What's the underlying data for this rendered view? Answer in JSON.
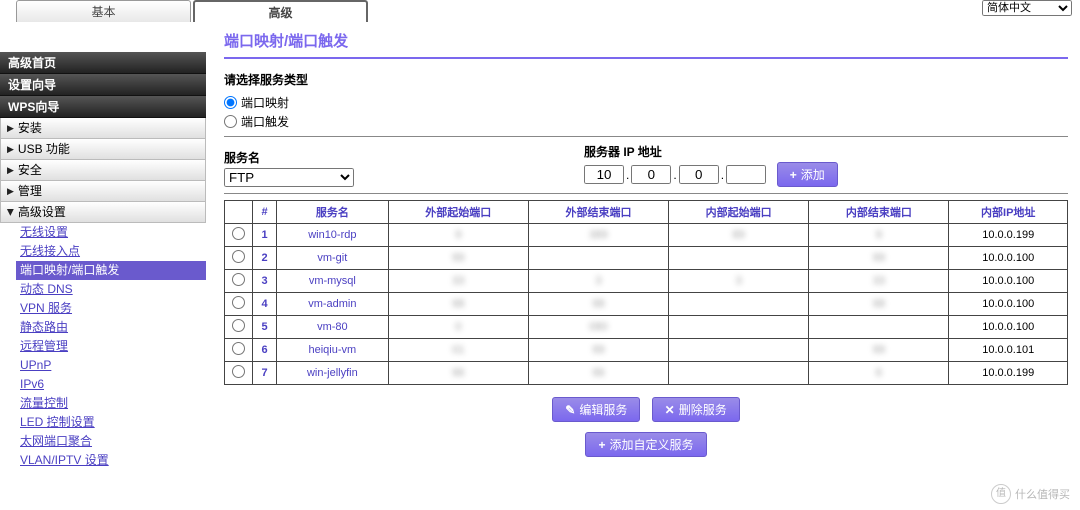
{
  "lang_selected": "简体中文",
  "tabs": {
    "basic": "基本",
    "advanced": "高级"
  },
  "sidebar": {
    "heads": [
      "高级首页",
      "设置向导",
      "WPS向导"
    ],
    "items": [
      "安装",
      "USB 功能",
      "安全",
      "管理",
      "高级设置"
    ],
    "subs": [
      "无线设置",
      "无线接入点",
      "端口映射/端口触发",
      "动态 DNS",
      "VPN 服务",
      "静态路由",
      "远程管理",
      "UPnP",
      "IPv6",
      "流量控制",
      "LED 控制设置",
      "太网端口聚合",
      "VLAN/IPTV 设置"
    ]
  },
  "page": {
    "title": "端口映射/端口触发",
    "select_type": "请选择服务类型",
    "radio1": "端口映射",
    "radio2": "端口触发",
    "service_name": "服务名",
    "service_selected": "FTP",
    "server_ip": "服务器 IP 地址",
    "ip": [
      "10",
      "0",
      "0",
      ""
    ],
    "add_btn": "添加",
    "edit_btn": "编辑服务",
    "del_btn": "删除服务",
    "custom_btn": "添加自定义服务"
  },
  "table": {
    "headers": [
      "",
      "#",
      "服务名",
      "外部起始端口",
      "外部结束端口",
      "内部起始端口",
      "内部结束端口",
      "内部IP地址"
    ],
    "rows": [
      {
        "n": "1",
        "name": "win10-rdp",
        "c1": "9",
        "c2": "389",
        "c3": "89",
        "c4": "9",
        "ip": "10.0.0.199"
      },
      {
        "n": "2",
        "name": "vm-git",
        "c1": "99",
        "c2": "",
        "c3": "",
        "c4": "99",
        "ip": "10.0.0.100"
      },
      {
        "n": "3",
        "name": "vm-mysql",
        "c1": "33",
        "c2": "3",
        "c3": "3",
        "c4": "33",
        "ip": "10.0.0.100"
      },
      {
        "n": "4",
        "name": "vm-admin",
        "c1": "98",
        "c2": "98",
        "c3": "",
        "c4": "98",
        "ip": "10.0.0.100"
      },
      {
        "n": "5",
        "name": "vm-80",
        "c1": "0",
        "c2": "080",
        "c3": "",
        "c4": "",
        "ip": "10.0.0.100"
      },
      {
        "n": "6",
        "name": "heiqiu-vm",
        "c1": "01",
        "c2": "99",
        "c3": "",
        "c4": "99",
        "ip": "10.0.0.101"
      },
      {
        "n": "7",
        "name": "win-jellyfin",
        "c1": "96",
        "c2": "96",
        "c3": "",
        "c4": "6",
        "ip": "10.0.0.199"
      }
    ]
  },
  "watermark": "什么值得买"
}
